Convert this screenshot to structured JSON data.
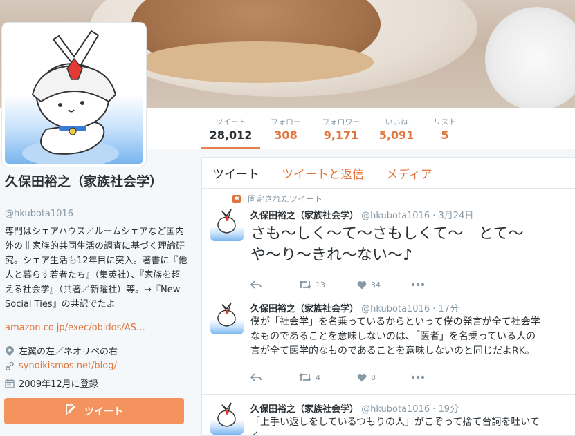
{
  "stats": [
    {
      "label": "ツイート",
      "value": "28,012",
      "active": true
    },
    {
      "label": "フォロー",
      "value": "308"
    },
    {
      "label": "フォロワー",
      "value": "9,171"
    },
    {
      "label": "いいね",
      "value": "5,091"
    },
    {
      "label": "リスト",
      "value": "5"
    }
  ],
  "profile": {
    "name": "久保田裕之（家族社会学）",
    "handle": "@hkubota1016",
    "bio": "専門はシェアハウス／ルームシェアなど国内外の非家族的共同生活の調査に基づく理論研究。シェア生活も12年目に突入。著書に『他人と暮らす若者たち』（集英社）、『家族を超える社会学』（共著／新曜社）等。→『New Social Ties』の共訳でたよ",
    "bio_link": "amazon.co.jp/exec/obidos/AS…",
    "location": "左翼の左／ネオリベの右",
    "website": "synoikismos.net/blog/",
    "joined": "2009年12月に登録",
    "tweet_button": "ツイート"
  },
  "tabs": [
    "ツイート",
    "ツイートと返信",
    "メディア"
  ],
  "tweets": [
    {
      "pinned_label": "固定されたツイート",
      "name": "久保田裕之（家族社会学）",
      "handle": "@hkubota1016",
      "time": "· 3月24日",
      "text1": "さも〜しく〜て〜さもしくて〜　とて〜",
      "text2": "や〜り〜きれ〜ない〜♪",
      "retweets": "13",
      "likes": "34"
    },
    {
      "name": "久保田裕之（家族社会学）",
      "handle": "@hkubota1016",
      "time": "· 17分",
      "text1": "僕が「社会学」を名乗っているからといって僕の発言が全て社会学",
      "text2": "なものであることを意味しないのは、「医者」を名乗っている人の",
      "text3": "言が全て医学的なものであることを意味しないのと同じだよRK。",
      "retweets": "4",
      "likes": "8"
    },
    {
      "name": "久保田裕之（家族社会学）",
      "handle": "@hkubota1016",
      "time": "· 19分",
      "text1": "「上手い返しをしているつもりの人」がこぞって捨て台詞を吐いて",
      "text2": "く。"
    }
  ]
}
